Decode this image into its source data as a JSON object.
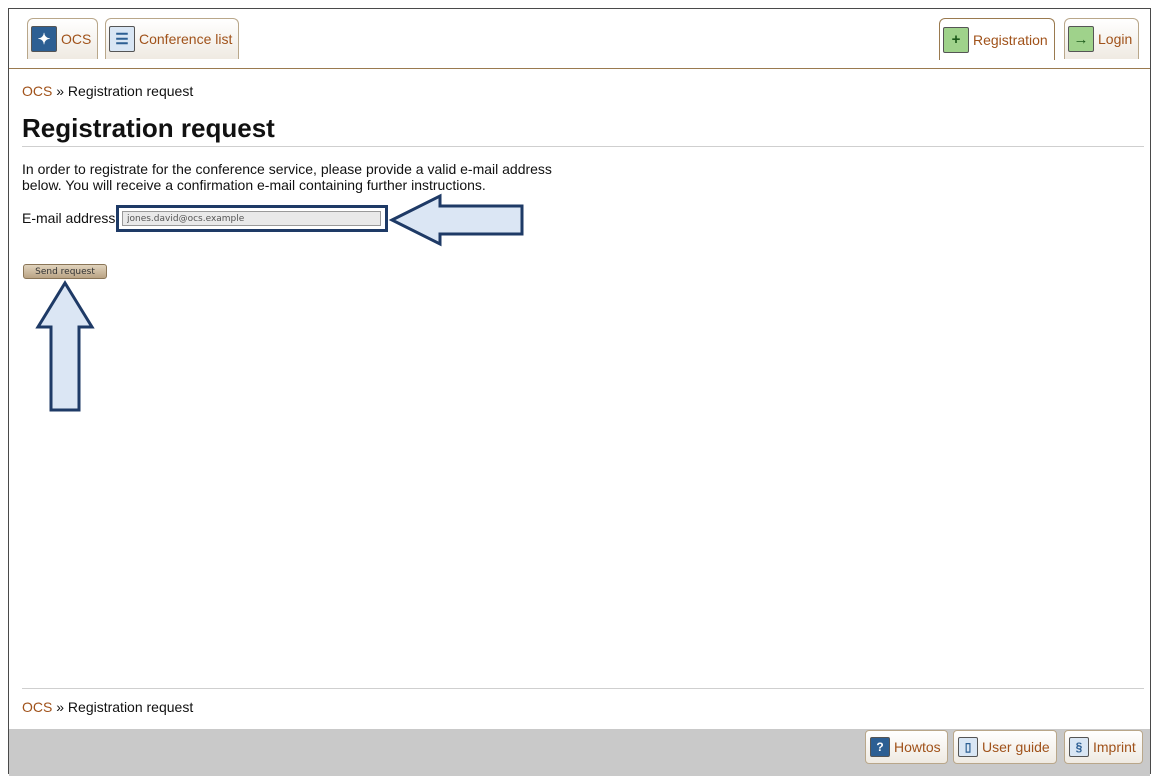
{
  "nav": {
    "tabs_left": [
      {
        "label": "OCS",
        "icon": "ocs-logo-icon"
      },
      {
        "label": "Conference list",
        "icon": "conference-list-icon"
      }
    ],
    "tabs_right": [
      {
        "label": "Registration",
        "icon": "registration-icon"
      },
      {
        "label": "Login",
        "icon": "login-icon"
      }
    ]
  },
  "breadcrumb": {
    "root": "OCS",
    "separator": "»",
    "current": "Registration request"
  },
  "page": {
    "title": "Registration request",
    "intro_line1": "In order to registrate for the conference service, please provide a valid e-mail address",
    "intro_line2": "below. You will receive a confirmation e-mail containing further instructions.",
    "email_label": "E-mail address",
    "email_value": "jones.david@ocs.example",
    "submit_label": "Send request"
  },
  "footer": {
    "breadcrumb": {
      "root": "OCS",
      "separator": "»",
      "current": "Registration request"
    },
    "links": [
      {
        "label": "Howtos",
        "icon": "help-icon"
      },
      {
        "label": "User guide",
        "icon": "book-icon"
      },
      {
        "label": "Imprint",
        "icon": "paragraph-icon"
      }
    ]
  },
  "colors": {
    "link": "#a0521a",
    "annotation_arrow_fill": "#dbe6f4",
    "annotation_arrow_stroke": "#1e3a66"
  }
}
